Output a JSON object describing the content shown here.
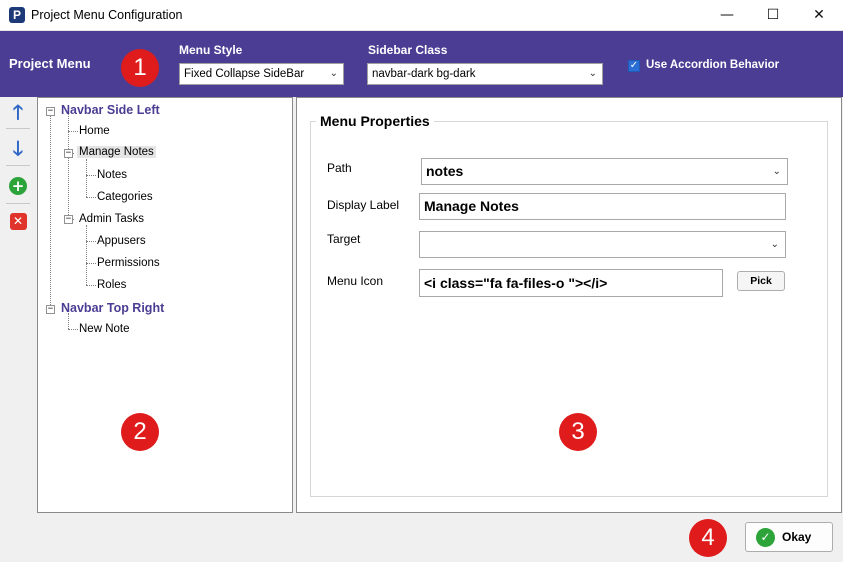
{
  "window": {
    "title": "Project Menu Configuration",
    "icon_letter": "P",
    "minimize": "—",
    "maximize": "☐",
    "close": "✕"
  },
  "header": {
    "title": "Project Menu",
    "menu_style_label": "Menu Style",
    "menu_style_value": "Fixed Collapse SideBar",
    "sidebar_class_label": "Sidebar Class",
    "sidebar_class_value": "navbar-dark bg-dark",
    "accordion_label": "Use Accordion Behavior",
    "accordion_checked": true
  },
  "badges": [
    "1",
    "2",
    "3",
    "4"
  ],
  "toolbar": {
    "up": "🡑",
    "down": "🡓",
    "add": "+",
    "delete": "✕"
  },
  "tree": {
    "roots": [
      {
        "label": "Navbar Side Left",
        "children": [
          {
            "label": "Home"
          },
          {
            "label": "Manage Notes",
            "children": [
              {
                "label": "Notes"
              },
              {
                "label": "Categories"
              }
            ]
          },
          {
            "label": "Admin Tasks",
            "children": [
              {
                "label": "Appusers"
              },
              {
                "label": "Permissions"
              },
              {
                "label": "Roles"
              }
            ]
          }
        ]
      },
      {
        "label": "Navbar Top Right",
        "children": [
          {
            "label": "New Note"
          }
        ]
      }
    ],
    "selected": "Manage Notes"
  },
  "properties": {
    "group_title": "Menu Properties",
    "path_label": "Path",
    "path_value": "notes",
    "display_label_label": "Display Label",
    "display_label_value": "Manage Notes",
    "target_label": "Target",
    "target_value": "",
    "menu_icon_label": "Menu Icon",
    "menu_icon_value": "<i class=\"fa fa-files-o \"></i>",
    "pick_label": "Pick"
  },
  "footer": {
    "okay_label": "Okay",
    "okay_icon": "✓"
  },
  "colors": {
    "header_bg": "#4b3d94",
    "tree_root": "#4b3d94",
    "badge": "#e01b1b",
    "accent_green": "#2ca43a",
    "accent_blue": "#2f67c6"
  }
}
